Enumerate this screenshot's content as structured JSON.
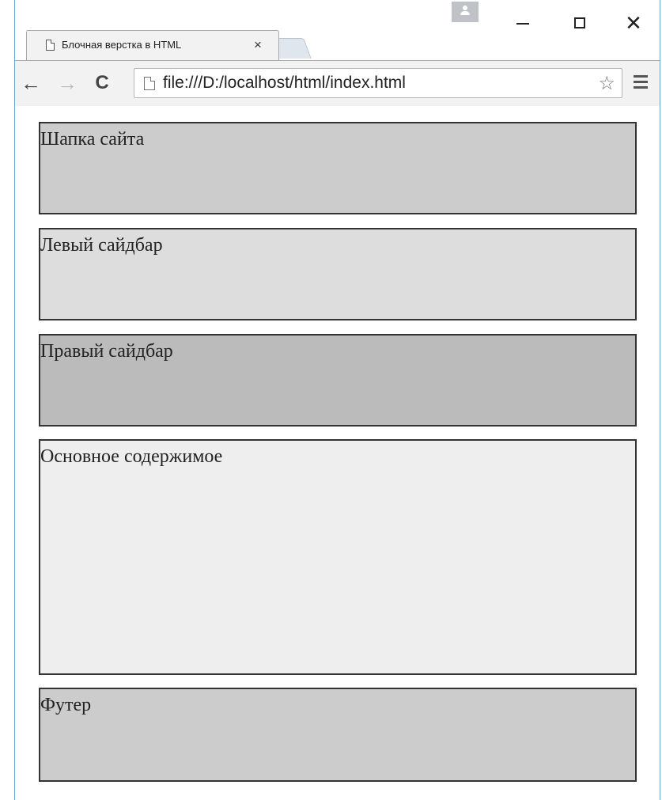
{
  "browser": {
    "tab_title": "Блочная верстка в HTML",
    "tab_close": "×",
    "address": "file:///D:/localhost/html/index.html",
    "back": "←",
    "forward": "→",
    "reload": "C",
    "bookmark_star": "☆",
    "close": "✕"
  },
  "page": {
    "blocks": [
      {
        "label": "Шапка сайта",
        "bg": "#cccccc"
      },
      {
        "label": "Левый сайдбар",
        "bg": "#dddddd"
      },
      {
        "label": "Правый сайдбар",
        "bg": "#bbbbbb"
      },
      {
        "label": "Основное содержимое",
        "bg": "#eeeeee"
      },
      {
        "label": "Футер",
        "bg": "#cccccc"
      }
    ]
  },
  "colors": {
    "window_border": "#6fa0c8",
    "toolbar_bg": "#f2f2f2"
  }
}
